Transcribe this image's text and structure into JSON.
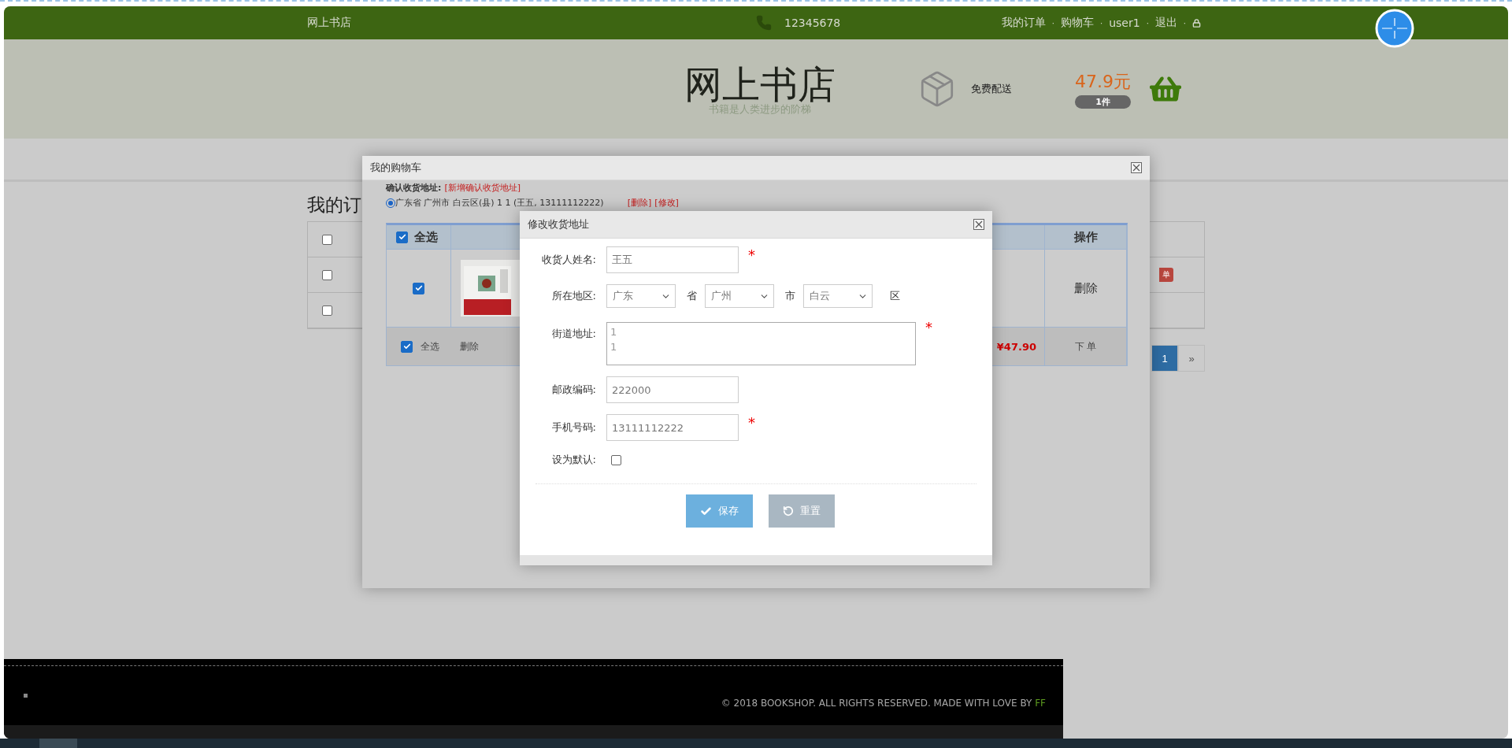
{
  "top_bar": {
    "brand": "网上书店",
    "phone": "12345678",
    "separator": "·",
    "links": [
      {
        "label": "我的订单"
      },
      {
        "label": "购物车"
      },
      {
        "label": "user1"
      },
      {
        "label": "退出"
      }
    ]
  },
  "header": {
    "title": "网上书店",
    "slogan": "书籍是人类进步的阶梯",
    "shipping": "免费配送",
    "cart_total": "47.9元",
    "cart_count": "1件"
  },
  "page": {
    "heading": "我的订",
    "rows": [
      {
        "checked": false
      },
      {
        "checked": false
      },
      {
        "checked": false
      }
    ],
    "order_button": "单",
    "pagination": [
      {
        "label": "1",
        "selected": true
      },
      {
        "label": "»",
        "selected": false
      }
    ]
  },
  "cart_dialog": {
    "title": "我的购物车",
    "address_label": "确认收货地址:",
    "add_address_link": "[新增确认收货地址]",
    "address": {
      "text": "广东省 广州市 白云区(县)  1 1  (王五, 13111112222)",
      "selected": true,
      "delete": "[删除]",
      "edit": "[修改]"
    },
    "table": {
      "select_all": {
        "label": "全选",
        "checked": true
      },
      "action_header": "操作",
      "rows": [
        {
          "checked": true,
          "action": "删除"
        }
      ],
      "footer": {
        "select_all": {
          "label": "全选",
          "checked": true
        },
        "delete": "删除",
        "total": "¥47.90",
        "order": "下 单"
      }
    }
  },
  "address_dialog": {
    "title": "修改收货地址",
    "fields": [
      {
        "kind": "text",
        "label": "收货人姓名:",
        "value": "王五",
        "mark": "*"
      },
      {
        "kind": "region",
        "label": "所在地区:",
        "selects": [
          {
            "value": "广东",
            "unit": "省"
          },
          {
            "value": "广州",
            "unit": "市"
          },
          {
            "value": "白云",
            "unit": "区"
          }
        ]
      },
      {
        "kind": "textarea",
        "label": "街道地址:",
        "value": "1\n1",
        "mark": "*"
      },
      {
        "kind": "text",
        "label": "邮政编码:",
        "value": "222000"
      },
      {
        "kind": "text",
        "label": "手机号码:",
        "value": "13111112222",
        "mark": "*"
      },
      {
        "kind": "checkbox",
        "label": "设为默认:",
        "checked": false
      }
    ],
    "buttons": [
      {
        "kind": "save",
        "label": "保存"
      },
      {
        "kind": "reset",
        "label": "重置"
      }
    ]
  },
  "footer": {
    "copyright": "© 2018 BOOKSHOP. ALL RIGHTS RESERVED. MADE WITH LOVE BY",
    "author": "FF"
  }
}
